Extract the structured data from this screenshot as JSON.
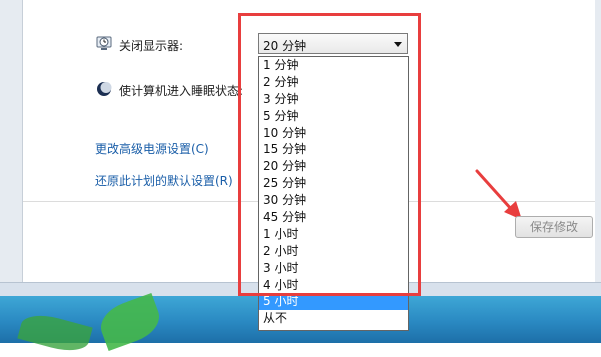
{
  "settings": {
    "display_label": "关闭显示器:",
    "sleep_label": "使计算机进入睡眠状态:"
  },
  "dropdown": {
    "selected_value": "20 分钟",
    "options": [
      "1 分钟",
      "2 分钟",
      "3 分钟",
      "5 分钟",
      "10 分钟",
      "15 分钟",
      "20 分钟",
      "25 分钟",
      "30 分钟",
      "45 分钟",
      "1 小时",
      "2 小时",
      "3 小时",
      "4 小时",
      "5 小时",
      "从不"
    ],
    "highlighted_option": "5 小时"
  },
  "links": {
    "advanced": "更改高级电源设置(C)",
    "restore": "还原此计划的默认设置(R)"
  },
  "buttons": {
    "save": "保存修改"
  },
  "icons": {
    "display": "monitor-clock-icon",
    "sleep": "moon-icon",
    "annotation": "red-arrow-icon"
  },
  "colors": {
    "annotation": "#e83e3e",
    "link": "#1a5ea8",
    "highlight": "#3399ff"
  }
}
